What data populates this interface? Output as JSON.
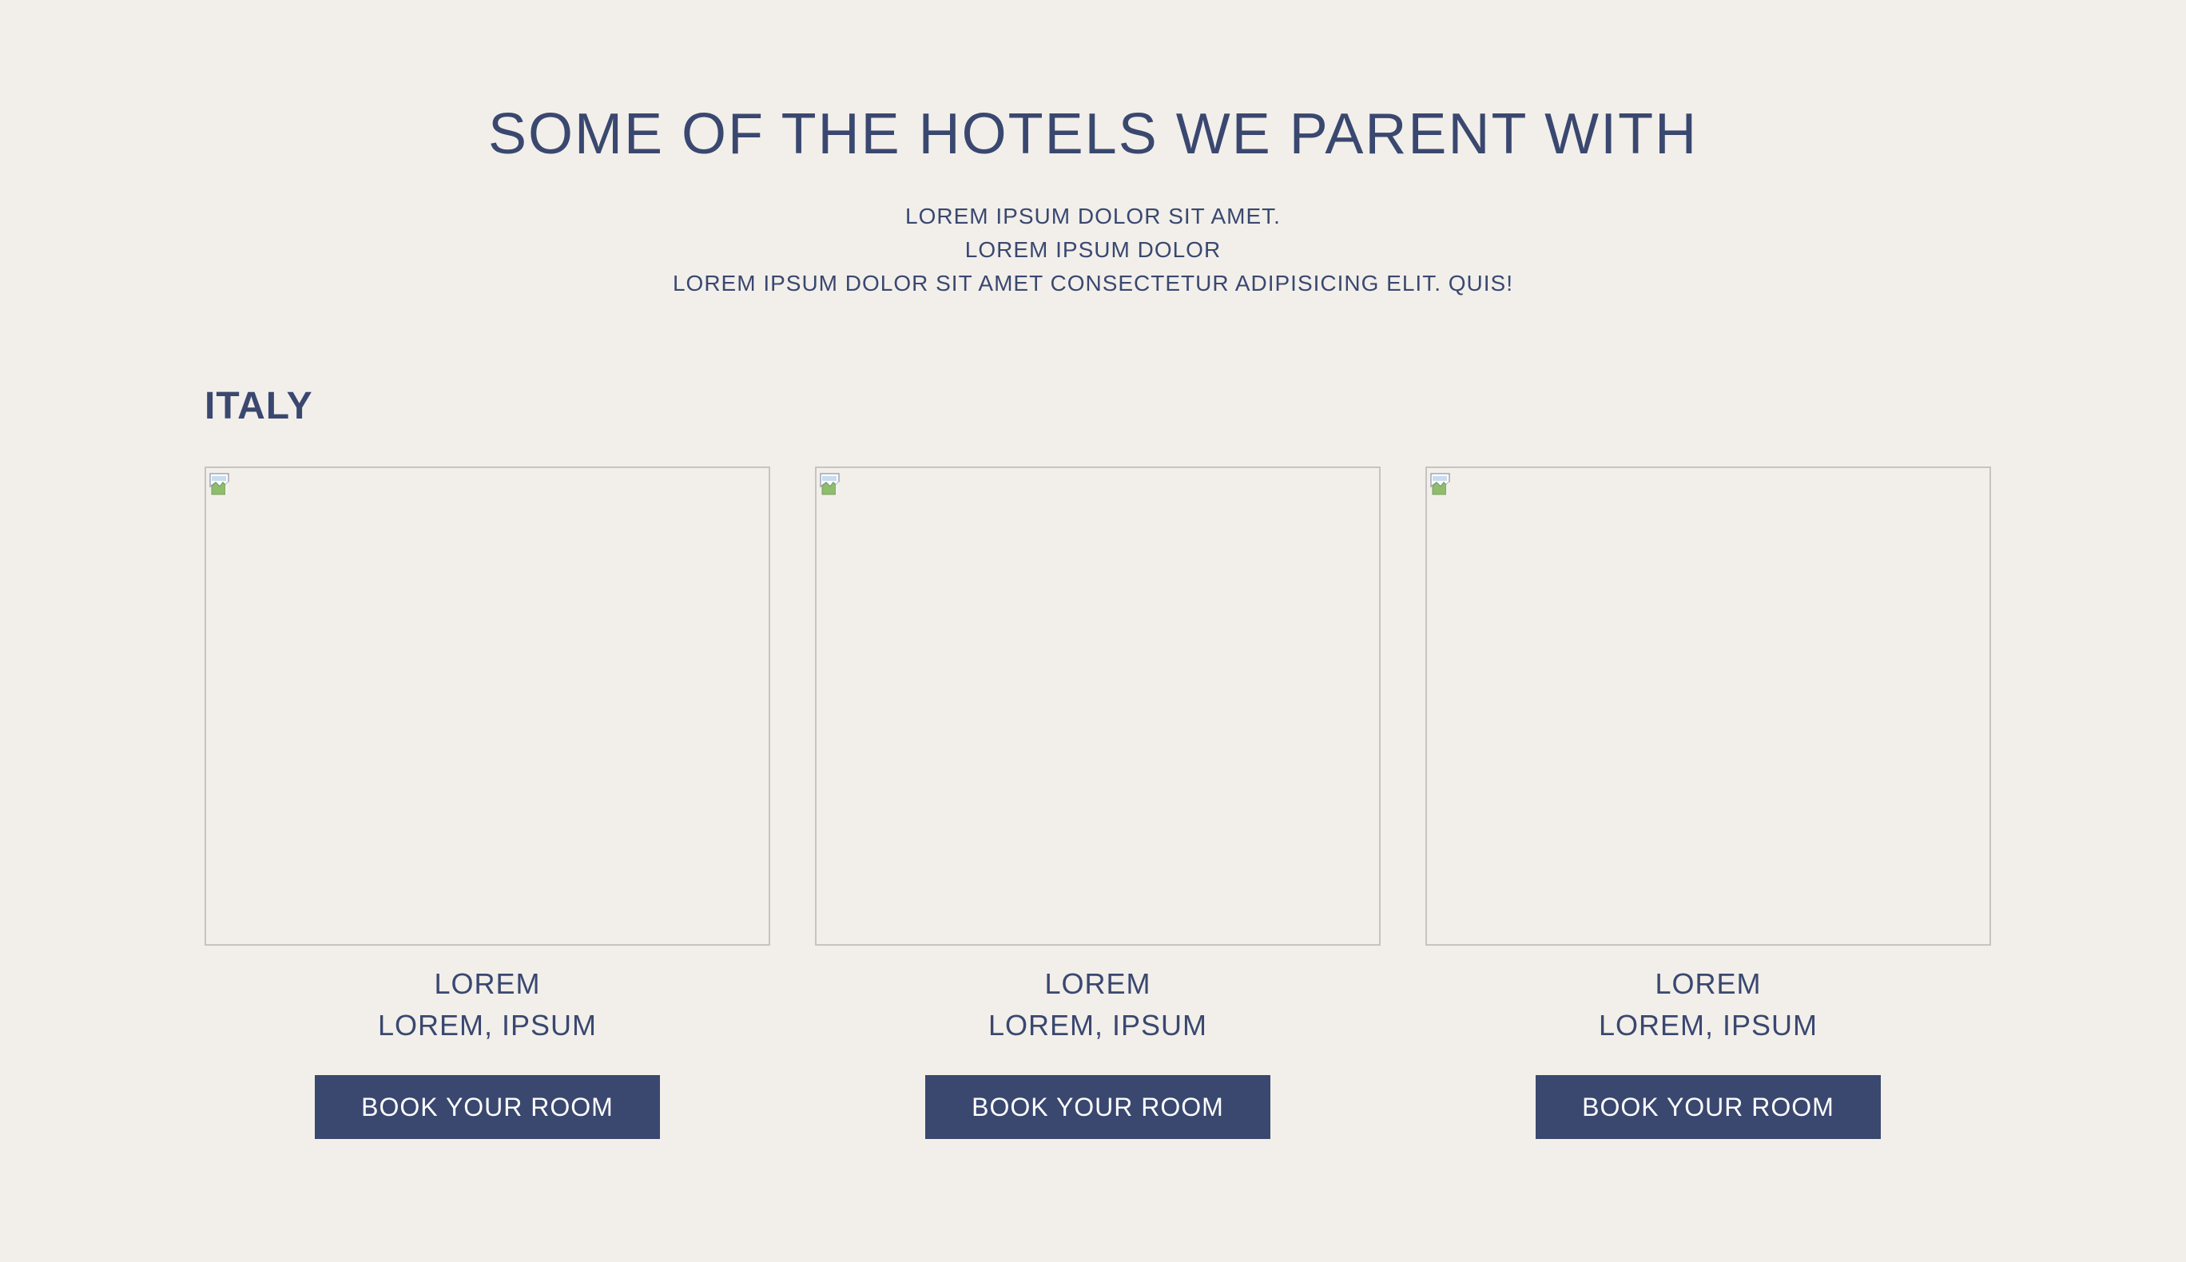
{
  "header": {
    "title": "SOME OF THE HOTELS WE PARENT WITH",
    "intro_lines": [
      "LOREM IPSUM DOLOR SIT AMET.",
      "LOREM IPSUM DOLOR",
      "LOREM IPSUM DOLOR SIT AMET CONSECTETUR ADIPISICING ELIT. QUIS!"
    ]
  },
  "section": {
    "country": "ITALY"
  },
  "hotels": [
    {
      "name": "LOREM",
      "location": "LOREM, IPSUM",
      "button_label": "BOOK YOUR ROOM",
      "image_state": "broken-image-icon"
    },
    {
      "name": "LOREM",
      "location": "LOREM, IPSUM",
      "button_label": "BOOK YOUR ROOM",
      "image_state": "broken-image-icon"
    },
    {
      "name": "LOREM",
      "location": "LOREM, IPSUM",
      "button_label": "BOOK YOUR ROOM",
      "image_state": "broken-image-icon"
    }
  ],
  "colors": {
    "background": "#f2efeb",
    "primary_text": "#3a4870",
    "button_background": "#3a4870",
    "button_text": "#ffffff",
    "image_border": "#c7c3c0"
  }
}
